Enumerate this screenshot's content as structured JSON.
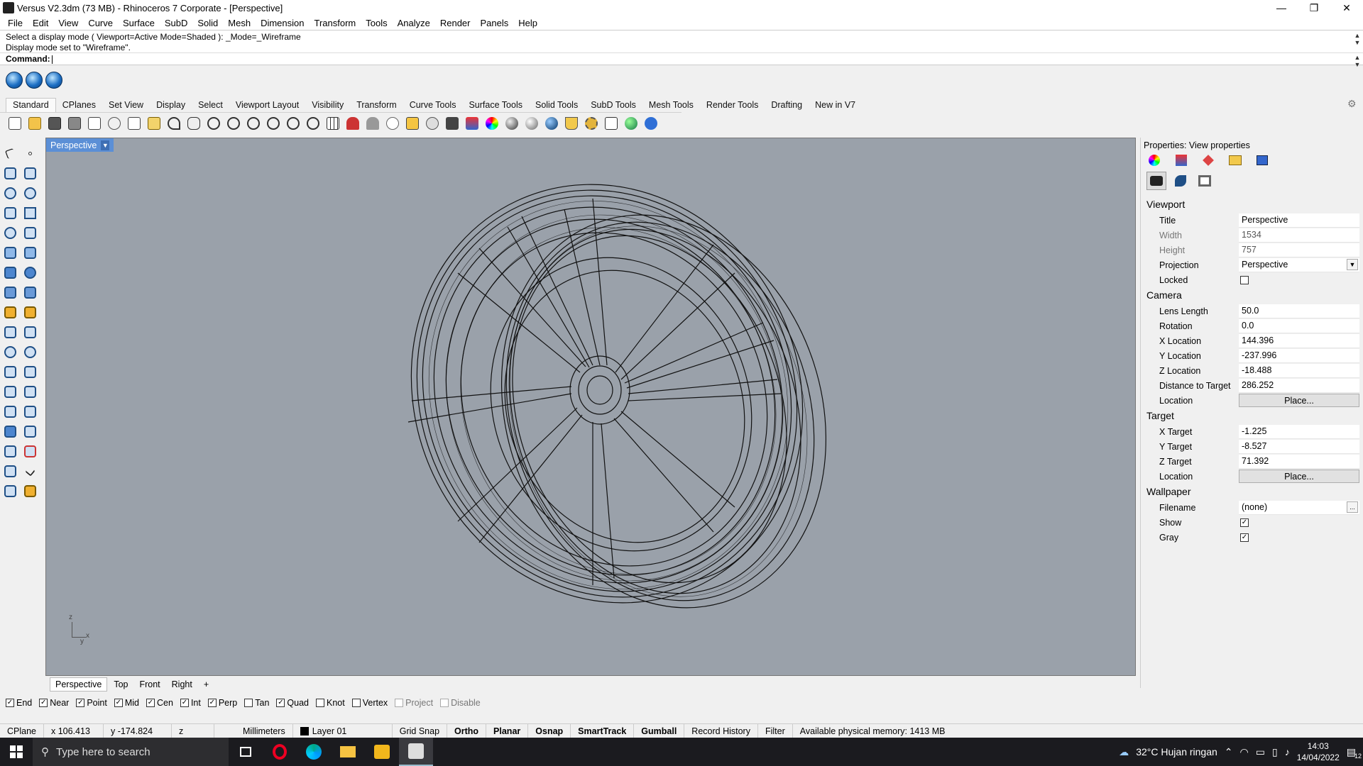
{
  "window": {
    "title": "Versus V2.3dm (73 MB) - Rhinoceros 7 Corporate - [Perspective]",
    "minimize": "—",
    "restore": "❐",
    "close": "✕"
  },
  "menu": [
    "File",
    "Edit",
    "View",
    "Curve",
    "Surface",
    "SubD",
    "Solid",
    "Mesh",
    "Dimension",
    "Transform",
    "Tools",
    "Analyze",
    "Render",
    "Panels",
    "Help"
  ],
  "command": {
    "history_1": "Select a display mode ( Viewport=Active  Mode=Shaded ): _Mode=_Wireframe",
    "history_2": "Display mode set to \"Wireframe\".",
    "prompt": "Command:"
  },
  "toolbar_tabs": [
    "Standard",
    "CPlanes",
    "Set View",
    "Display",
    "Select",
    "Viewport Layout",
    "Visibility",
    "Transform",
    "Curve Tools",
    "Surface Tools",
    "Solid Tools",
    "SubD Tools",
    "Mesh Tools",
    "Render Tools",
    "Drafting",
    "New in V7"
  ],
  "active_tab": "Standard",
  "viewport": {
    "label": "Perspective",
    "axis_z": "z",
    "axis_x": "x",
    "axis_y": "y",
    "display_mode": "Wireframe"
  },
  "viewport_tabs": [
    "Perspective",
    "Top",
    "Front",
    "Right"
  ],
  "viewport_tabs_add": "+",
  "osnaps": [
    {
      "label": "End",
      "checked": true,
      "disabled": false
    },
    {
      "label": "Near",
      "checked": true,
      "disabled": false
    },
    {
      "label": "Point",
      "checked": true,
      "disabled": false
    },
    {
      "label": "Mid",
      "checked": true,
      "disabled": false
    },
    {
      "label": "Cen",
      "checked": true,
      "disabled": false
    },
    {
      "label": "Int",
      "checked": true,
      "disabled": false
    },
    {
      "label": "Perp",
      "checked": true,
      "disabled": false
    },
    {
      "label": "Tan",
      "checked": false,
      "disabled": false
    },
    {
      "label": "Quad",
      "checked": true,
      "disabled": false
    },
    {
      "label": "Knot",
      "checked": false,
      "disabled": false
    },
    {
      "label": "Vertex",
      "checked": false,
      "disabled": false
    },
    {
      "label": "Project",
      "checked": false,
      "disabled": true
    },
    {
      "label": "Disable",
      "checked": false,
      "disabled": true
    }
  ],
  "status": {
    "cplane": "CPlane",
    "x": "x 106.413",
    "y": "y -174.824",
    "z": "z",
    "units": "Millimeters",
    "layer": "Layer 01",
    "grid_snap": "Grid Snap",
    "ortho": "Ortho",
    "planar": "Planar",
    "osnap": "Osnap",
    "smarttrack": "SmartTrack",
    "gumball": "Gumball",
    "record_history": "Record History",
    "filter": "Filter",
    "memory": "Available physical memory: 1413 MB"
  },
  "properties": {
    "title": "Properties: View properties",
    "sections": {
      "viewport": "Viewport",
      "camera": "Camera",
      "target": "Target",
      "wallpaper": "Wallpaper"
    },
    "viewport_rows": [
      {
        "label": "Title",
        "value": "Perspective"
      },
      {
        "label": "Width",
        "value": "1534"
      },
      {
        "label": "Height",
        "value": "757"
      },
      {
        "label": "Projection",
        "value": "Perspective"
      },
      {
        "label": "Locked",
        "value": ""
      }
    ],
    "camera_rows": [
      {
        "label": "Lens Length",
        "value": "50.0"
      },
      {
        "label": "Rotation",
        "value": "0.0"
      },
      {
        "label": "X Location",
        "value": "144.396"
      },
      {
        "label": "Y Location",
        "value": "-237.996"
      },
      {
        "label": "Z Location",
        "value": "-18.488"
      },
      {
        "label": "Distance to Target",
        "value": "286.252"
      },
      {
        "label": "Location",
        "value": "Place..."
      }
    ],
    "target_rows": [
      {
        "label": "X Target",
        "value": "-1.225"
      },
      {
        "label": "Y Target",
        "value": "-8.527"
      },
      {
        "label": "Z Target",
        "value": "71.392"
      },
      {
        "label": "Location",
        "value": "Place..."
      }
    ],
    "wallpaper_rows": [
      {
        "label": "Filename",
        "value": "(none)"
      },
      {
        "label": "Show",
        "value": ""
      },
      {
        "label": "Gray",
        "value": ""
      }
    ],
    "browse": "...",
    "locked_checked": false,
    "show_checked": true,
    "gray_checked": true
  },
  "taskbar": {
    "search_placeholder": "Type here to search",
    "weather": "32°C  Hujan ringan",
    "time": "14:03",
    "date": "14/04/2022",
    "notif_count": "12"
  },
  "colors": {
    "viewport_bg": "#9aa1aa",
    "viewport_label_bg": "#5b8fd6",
    "taskbar_bg": "#1b1b1f"
  }
}
